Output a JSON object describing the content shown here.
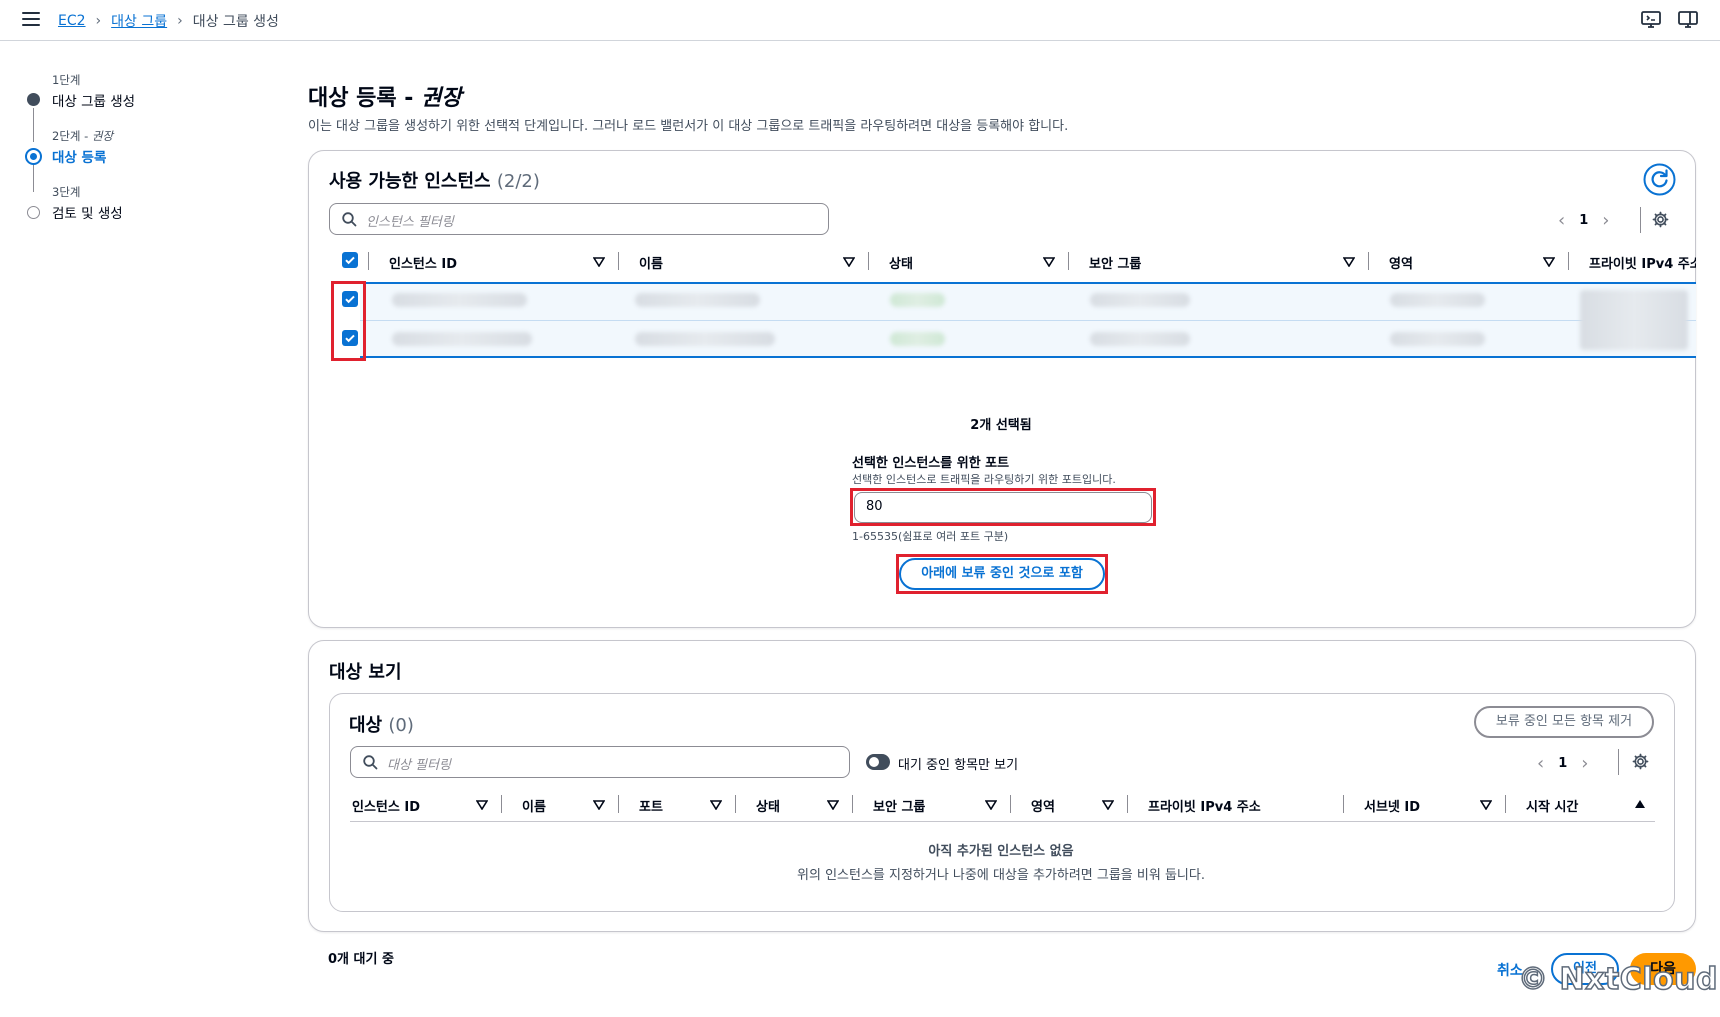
{
  "breadcrumb": {
    "root": "EC2",
    "parent": "대상 그룹",
    "current": "대상 그룹 생성"
  },
  "steps": [
    {
      "small": "1단계",
      "label": "대상 그룹 생성",
      "state": "done"
    },
    {
      "small": "2단계 - ",
      "small_em": "권장",
      "label": "대상 등록",
      "state": "active"
    },
    {
      "small": "3단계",
      "label": "검토 및 생성",
      "state": "pending"
    }
  ],
  "page": {
    "title": "대상 등록 - ",
    "title_em": "권장",
    "description": "이는 대상 그룹을 생성하기 위한 선택적 단계입니다. 그러나 로드 밸런서가 이 대상 그룹으로 트래픽을 라우팅하려면 대상을 등록해야 합니다."
  },
  "available": {
    "title": "사용 가능한 인스턴스",
    "count": "(2/2)",
    "search_placeholder": "인스턴스 필터링",
    "page": "1",
    "columns": [
      "인스턴스 ID",
      "이름",
      "상태",
      "보안 그룹",
      "영역",
      "프라이빗 IPv4 주소"
    ],
    "selected_text": "2개 선택됨",
    "port_label": "선택한 인스턴스를 위한 포트",
    "port_help": "선택한 인스턴스로 트래픽을 라우팅하기 위한 포트입니다.",
    "port_value": "80",
    "port_constraint": "1-65535(쉼표로 여러 포트 구분)",
    "include_button": "아래에 보류 중인 것으로 포함"
  },
  "review": {
    "title": "대상 보기",
    "targets_title": "대상",
    "targets_count": "(0)",
    "remove_all_button": "보류 중인 모든 항목 제거",
    "search_placeholder": "대상 필터링",
    "toggle_label": "대기 중인 항목만 보기",
    "page": "1",
    "columns": [
      "인스턴스 ID",
      "이름",
      "포트",
      "상태",
      "보안 그룹",
      "영역",
      "프라이빗 IPv4 주소",
      "서브넷 ID",
      "시작 시간"
    ],
    "empty_title": "아직 추가된 인스턴스 없음",
    "empty_desc": "위의 인스턴스를 지정하거나 나중에 대상을 추가하려면 그룹을 비워 둡니다."
  },
  "footer": {
    "pending": "0개 대기 중",
    "cancel": "취소",
    "previous": "이전",
    "next": "다음"
  },
  "watermark": "© NxtCloud",
  "colors": {
    "accent": "#0972d3",
    "primary_button": "#ff9900",
    "highlight": "#e0212e"
  }
}
